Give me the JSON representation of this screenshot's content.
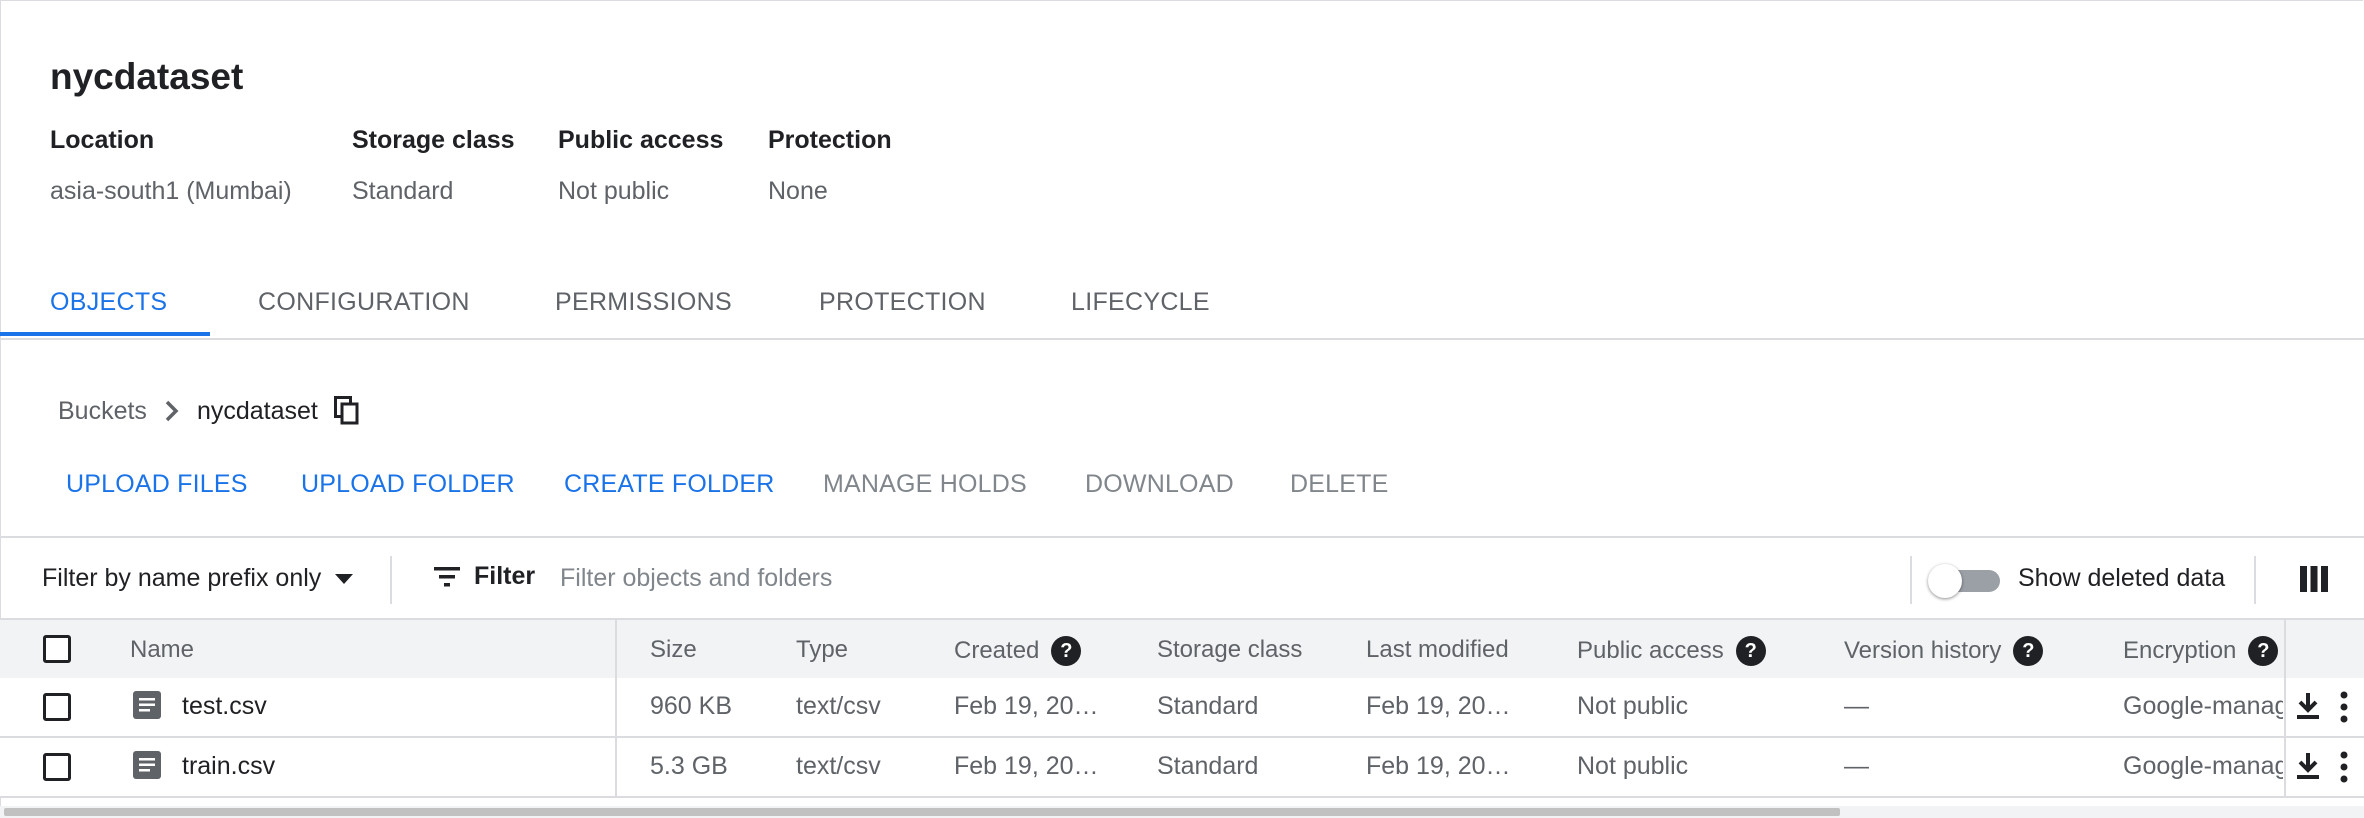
{
  "bucket": {
    "name": "nycdataset",
    "meta": [
      {
        "label": "Location",
        "value": "asia-south1 (Mumbai)"
      },
      {
        "label": "Storage class",
        "value": "Standard"
      },
      {
        "label": "Public access",
        "value": "Not public"
      },
      {
        "label": "Protection",
        "value": "None"
      }
    ]
  },
  "tabs": [
    {
      "label": "OBJECTS",
      "active": true
    },
    {
      "label": "CONFIGURATION",
      "active": false
    },
    {
      "label": "PERMISSIONS",
      "active": false
    },
    {
      "label": "PROTECTION",
      "active": false
    },
    {
      "label": "LIFECYCLE",
      "active": false
    }
  ],
  "breadcrumb": {
    "root": "Buckets",
    "current": "nycdataset"
  },
  "actions": [
    {
      "label": "UPLOAD FILES",
      "enabled": true
    },
    {
      "label": "UPLOAD FOLDER",
      "enabled": true
    },
    {
      "label": "CREATE FOLDER",
      "enabled": true
    },
    {
      "label": "MANAGE HOLDS",
      "enabled": false
    },
    {
      "label": "DOWNLOAD",
      "enabled": false
    },
    {
      "label": "DELETE",
      "enabled": false
    }
  ],
  "filterbar": {
    "prefix_select": "Filter by name prefix only",
    "filter_label": "Filter",
    "placeholder": "Filter objects and folders",
    "toggle_label": "Show deleted data"
  },
  "table": {
    "columns": [
      "Name",
      "Size",
      "Type",
      "Created",
      "Storage class",
      "Last modified",
      "Public access",
      "Version history",
      "Encryption"
    ],
    "rows": [
      {
        "name": "test.csv",
        "size": "960 KB",
        "type": "text/csv",
        "created": "Feb 19, 20…",
        "storage_class": "Standard",
        "last_modified": "Feb 19, 20…",
        "public_access": "Not public",
        "version_history": "—",
        "encryption": "Google-manag"
      },
      {
        "name": "train.csv",
        "size": "5.3 GB",
        "type": "text/csv",
        "created": "Feb 19, 20…",
        "storage_class": "Standard",
        "last_modified": "Feb 19, 20…",
        "public_access": "Not public",
        "version_history": "—",
        "encryption": "Google-manag"
      }
    ]
  },
  "colors": {
    "accent": "#1a73e8",
    "text_primary": "#202124",
    "text_secondary": "#5f6368",
    "divider": "#dadce0"
  },
  "icons": [
    "chevron-right-icon",
    "copy-icon",
    "dropdown-caret-icon",
    "filter-list-icon",
    "column-display-icon",
    "help-icon",
    "file-icon",
    "download-icon",
    "more-vert-icon"
  ]
}
